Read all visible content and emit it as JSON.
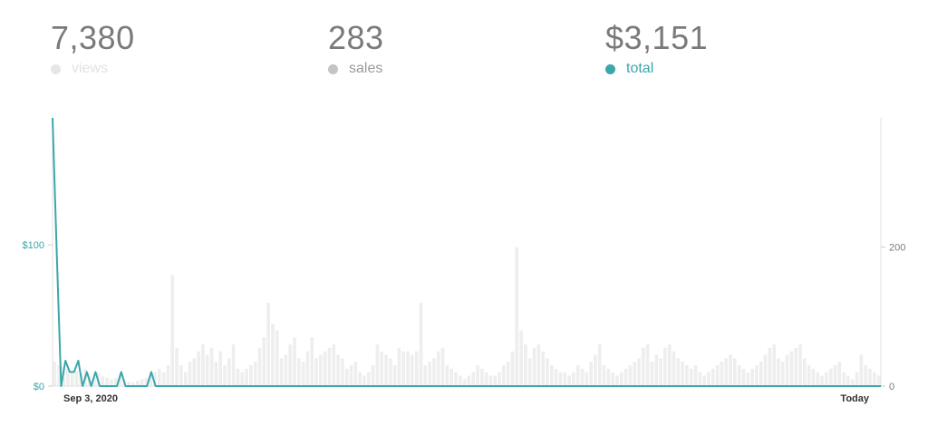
{
  "stats": [
    {
      "value": "7,380",
      "label": "views",
      "color": "#e6e6e6",
      "label_color": "#e2e2e2"
    },
    {
      "value": "283",
      "label": "sales",
      "color": "#c4c4c4",
      "label_color": "#9a9a9a"
    },
    {
      "value": "$3,151",
      "label": "total",
      "color": "#3aa7aa",
      "label_color": "#3aa7aa"
    }
  ],
  "chart_data": {
    "type": "bar+line",
    "x_start_label": "Sep 3, 2020",
    "x_end_label": "Today",
    "left_axis": {
      "ticks": [
        {
          "value": 0,
          "label": "$0"
        },
        {
          "value": 100,
          "label": "$100"
        }
      ],
      "ylim": [
        0,
        190
      ],
      "color": "#3aa7aa"
    },
    "right_axis": {
      "ticks": [
        {
          "value": 0,
          "label": "0"
        },
        {
          "value": 200,
          "label": "200"
        }
      ],
      "ylim": [
        0,
        386
      ],
      "color": "#7a7a7a"
    },
    "series": [
      {
        "name": "views",
        "kind": "bar",
        "axis": "right",
        "color": "#eeeeee",
        "values": [
          35,
          30,
          28,
          25,
          20,
          22,
          18,
          25,
          15,
          12,
          20,
          14,
          12,
          10,
          12,
          15,
          8,
          6,
          5,
          8,
          10,
          12,
          15,
          20,
          25,
          20,
          30,
          160,
          55,
          30,
          20,
          35,
          40,
          50,
          60,
          45,
          55,
          35,
          50,
          30,
          40,
          60,
          25,
          20,
          25,
          30,
          35,
          55,
          70,
          120,
          90,
          80,
          40,
          45,
          60,
          70,
          40,
          35,
          50,
          70,
          40,
          45,
          50,
          55,
          60,
          45,
          40,
          25,
          30,
          35,
          20,
          15,
          20,
          30,
          60,
          50,
          45,
          40,
          30,
          55,
          50,
          50,
          45,
          50,
          120,
          30,
          35,
          40,
          50,
          55,
          30,
          25,
          20,
          15,
          10,
          15,
          20,
          30,
          25,
          20,
          15,
          15,
          20,
          30,
          35,
          50,
          200,
          80,
          60,
          40,
          55,
          60,
          50,
          40,
          30,
          25,
          20,
          20,
          15,
          20,
          30,
          25,
          20,
          35,
          45,
          60,
          30,
          25,
          20,
          15,
          20,
          25,
          30,
          35,
          40,
          55,
          60,
          35,
          45,
          40,
          55,
          60,
          50,
          40,
          35,
          30,
          25,
          30,
          20,
          15,
          20,
          25,
          30,
          35,
          40,
          45,
          40,
          30,
          25,
          20,
          25,
          30,
          35,
          45,
          55,
          60,
          40,
          35,
          45,
          50,
          55,
          60,
          40,
          30,
          25,
          20,
          15,
          20,
          25,
          30,
          35,
          20,
          15,
          10,
          20,
          45,
          30,
          25,
          20,
          15
        ]
      },
      {
        "name": "total",
        "kind": "line",
        "axis": "left",
        "color": "#3aa7aa",
        "values": [
          190,
          92,
          0,
          18,
          10,
          10,
          18,
          0,
          10,
          0,
          10,
          0,
          0,
          0,
          0,
          0,
          10,
          0,
          0,
          0,
          0,
          0,
          0,
          10,
          0,
          0,
          0,
          0,
          0,
          0,
          0,
          0,
          0,
          0,
          0,
          0,
          0,
          0,
          0,
          0,
          0,
          0,
          0,
          0,
          0,
          0,
          0,
          0,
          0,
          0,
          0,
          0,
          0,
          0,
          0,
          0,
          0,
          0,
          0,
          0,
          0,
          0,
          0,
          0,
          0,
          0,
          0,
          0,
          0,
          0,
          0,
          0,
          0,
          0,
          0,
          0,
          0,
          0,
          0,
          0,
          0,
          0,
          0,
          0,
          0,
          0,
          0,
          0,
          0,
          0,
          0,
          0,
          0,
          0,
          0,
          0,
          0,
          0,
          0,
          0,
          0,
          0,
          0,
          0,
          0,
          0,
          0,
          0,
          0,
          0,
          0,
          0,
          0,
          0,
          0,
          0,
          0,
          0,
          0,
          0,
          0,
          0,
          0,
          0,
          0,
          0,
          0,
          0,
          0,
          0,
          0,
          0,
          0,
          0,
          0,
          0,
          0,
          0,
          0,
          0,
          0,
          0,
          0,
          0,
          0,
          0,
          0,
          0,
          0,
          0,
          0,
          0,
          0,
          0,
          0,
          0,
          0,
          0,
          0,
          0,
          0,
          0,
          0,
          0,
          0,
          0,
          0,
          0,
          0,
          0,
          0,
          0,
          0,
          0,
          0,
          0,
          0,
          0,
          0,
          0,
          0,
          0,
          0,
          0,
          0,
          0,
          0,
          0,
          0,
          0,
          0,
          0,
          0,
          0
        ]
      }
    ],
    "grid": false,
    "legend": "top"
  }
}
